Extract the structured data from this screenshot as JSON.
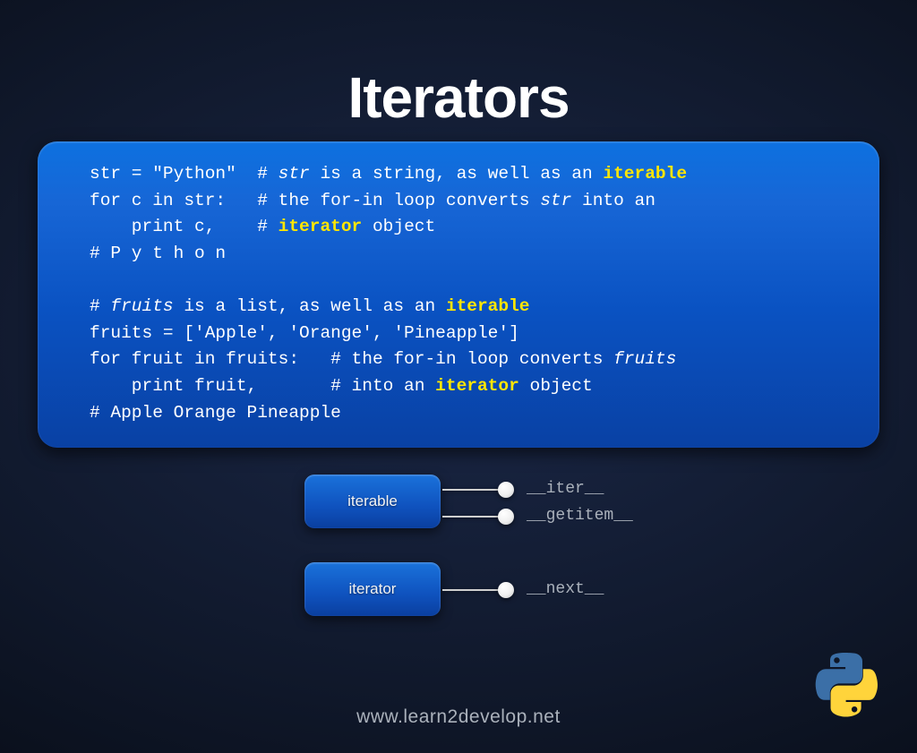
{
  "title": "Iterators",
  "code": {
    "l01_a": "str = \"Python\"  ",
    "l01_b": "# ",
    "l01_c": "str",
    "l01_d": " is a string, as well as an ",
    "l01_e": "iterable",
    "l02_a": "for c in str:   # the for-in loop converts ",
    "l02_b": "str",
    "l02_c": " into an",
    "l03_a": "    print c,    # ",
    "l03_b": "iterator",
    "l03_c": " object",
    "l04": "# P y t h o n",
    "l05": "",
    "l06_a": "# ",
    "l06_b": "fruits",
    "l06_c": " is a list, as well as an ",
    "l06_d": "iterable",
    "l07": "fruits = ['Apple', 'Orange', 'Pineapple']",
    "l08_a": "for fruit in fruits:   # the for-in loop converts ",
    "l08_b": "fruits",
    "l09_a": "    print fruit,       # into an ",
    "l09_b": "iterator",
    "l09_c": " object",
    "l10": "# Apple Orange Pineapple"
  },
  "boxes": {
    "iterable": "iterable",
    "iterator": "iterator"
  },
  "methods": {
    "iter": "__iter__",
    "getitem": "__getitem__",
    "next": "__next__"
  },
  "footer": "www.learn2develop.net"
}
